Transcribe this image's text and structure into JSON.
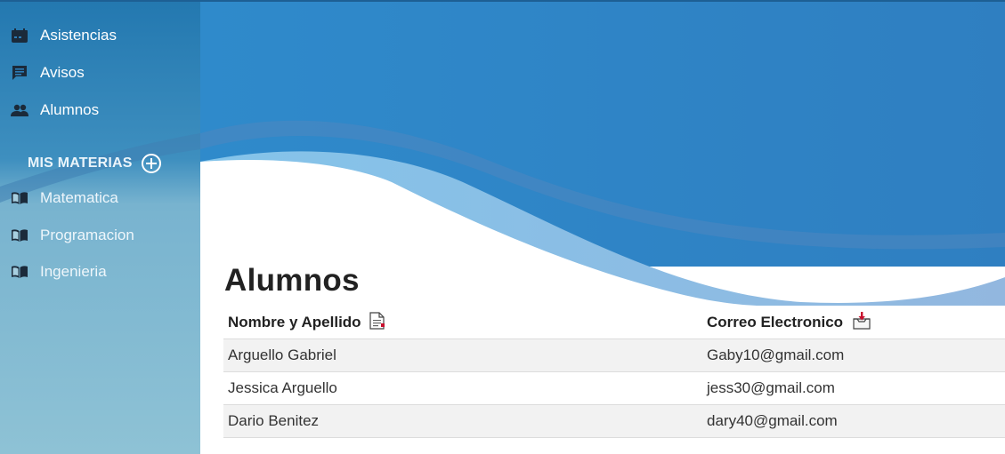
{
  "colors": {
    "sidebar_top": "#2577b0",
    "sidebar_bottom": "#8cc0d4",
    "header_blue": "#2f86c8",
    "wave_light": "#8fc4e6",
    "accent_red": "#c8102e"
  },
  "sidebar": {
    "items": [
      {
        "label": "Asistencias",
        "icon": "calendar-icon"
      },
      {
        "label": "Avisos",
        "icon": "message-icon"
      },
      {
        "label": "Alumnos",
        "icon": "people-icon"
      }
    ],
    "section_title": "MIS MATERIAS",
    "section_add_icon": "plus-circle-icon",
    "materias": [
      {
        "label": "Matematica",
        "icon": "book-icon"
      },
      {
        "label": "Programacion",
        "icon": "book-icon"
      },
      {
        "label": "Ingenieria",
        "icon": "book-icon"
      }
    ]
  },
  "main": {
    "title": "Alumnos",
    "columns": [
      {
        "label": "Nombre y Apellido",
        "icon": "document-icon"
      },
      {
        "label": "Correo Electronico",
        "icon": "inbox-icon"
      }
    ],
    "rows": [
      {
        "name": "Arguello Gabriel",
        "email": "Gaby10@gmail.com"
      },
      {
        "name": "Jessica Arguello",
        "email": "jess30@gmail.com"
      },
      {
        "name": "Dario Benitez",
        "email": "dary40@gmail.com"
      }
    ]
  }
}
